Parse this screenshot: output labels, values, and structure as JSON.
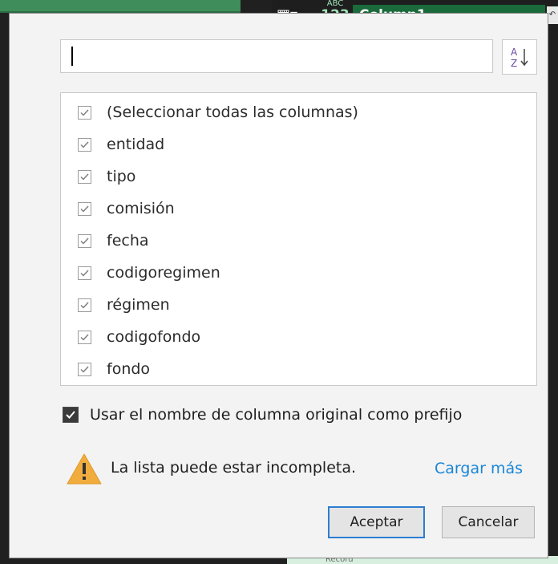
{
  "background": {
    "header_column_name": "Column1",
    "type_badge_top": "ABC",
    "type_badge_bottom": "123",
    "bottom_row_text": "Record"
  },
  "search": {
    "value": "",
    "placeholder": ""
  },
  "sort": {
    "icon": "sort-az-icon"
  },
  "columns": [
    {
      "label": "(Seleccionar todas las columnas)",
      "checked": true
    },
    {
      "label": "entidad",
      "checked": true
    },
    {
      "label": "tipo",
      "checked": true
    },
    {
      "label": "comisión",
      "checked": true
    },
    {
      "label": "fecha",
      "checked": true
    },
    {
      "label": "codigoregimen",
      "checked": true
    },
    {
      "label": "régimen",
      "checked": true
    },
    {
      "label": "codigofondo",
      "checked": true
    },
    {
      "label": "fondo",
      "checked": true
    }
  ],
  "prefix_option": {
    "label": "Usar el nombre de columna original como prefijo",
    "checked": true
  },
  "warning": {
    "icon": "warning-icon",
    "text": "La lista puede estar incompleta.",
    "load_more": "Cargar más"
  },
  "buttons": {
    "ok": "Aceptar",
    "cancel": "Cancelar"
  },
  "colors": {
    "accent": "#2d7dd2",
    "link": "#1a86d6",
    "warning": "#f0ad3e",
    "header_green": "#1a6a3b"
  }
}
